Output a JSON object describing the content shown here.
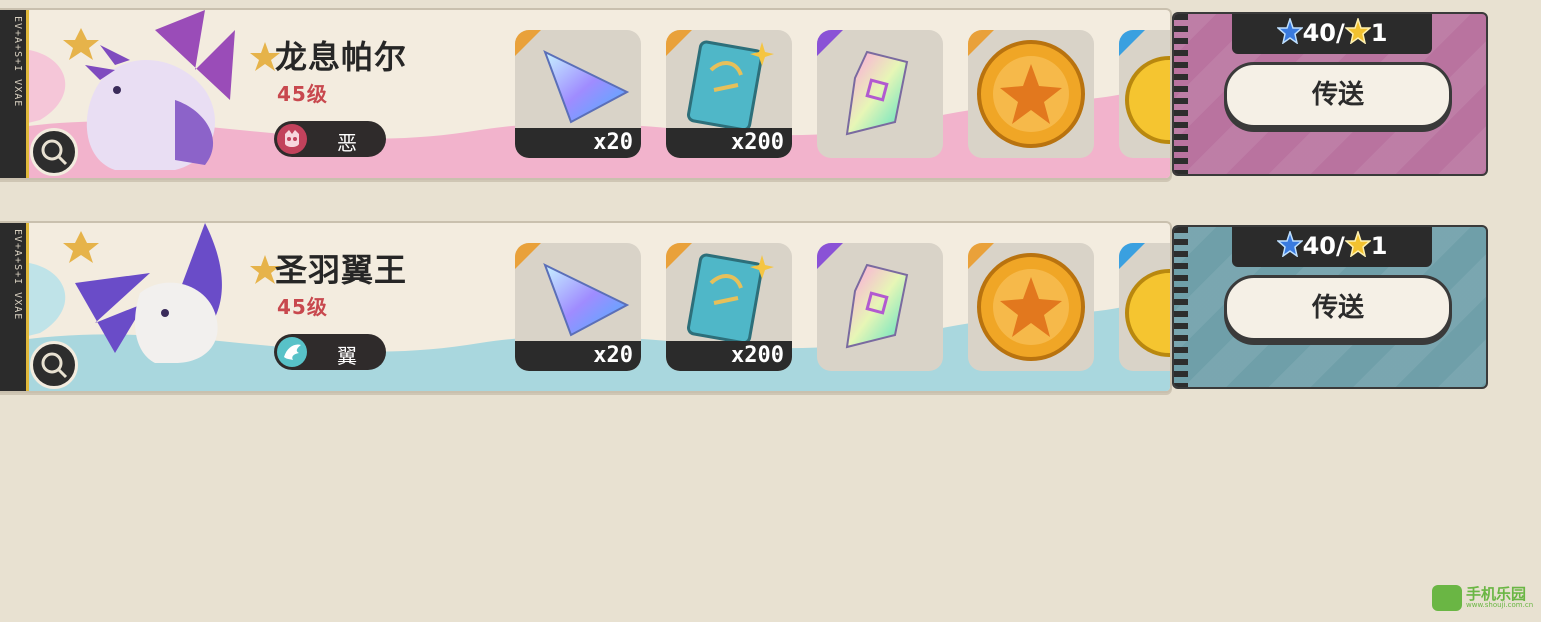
{
  "colors": {
    "background": "#e8e1d1",
    "card1_accent": "#f2b3cc",
    "card2_accent": "#a9d7de",
    "panel1": "#b9739f",
    "panel2": "#6f9fa9",
    "level_red": "#c8484e"
  },
  "cards": [
    {
      "name": "龙息帕尔",
      "level": "45级",
      "type_label": "恶",
      "type_icon": "dark-type-icon",
      "side_text": "EV+A+S+I VXAE",
      "items": [
        {
          "icon": "prism-crystal-icon",
          "qty": "x20"
        },
        {
          "icon": "skill-book-icon",
          "qty": "x200"
        },
        {
          "icon": "gem-shard-icon",
          "qty": ""
        },
        {
          "icon": "gold-medal-icon",
          "qty": ""
        }
      ],
      "stars": "40/",
      "stars_gold": "1",
      "button": "传送"
    },
    {
      "name": "圣羽翼王",
      "level": "45级",
      "type_label": "翼",
      "type_icon": "wing-type-icon",
      "side_text": "EV+A+S+I VXAE",
      "items": [
        {
          "icon": "prism-crystal-icon",
          "qty": "x20"
        },
        {
          "icon": "skill-book-icon",
          "qty": "x200"
        },
        {
          "icon": "gem-shard-icon",
          "qty": ""
        },
        {
          "icon": "gold-medal-icon",
          "qty": ""
        }
      ],
      "stars": "40/",
      "stars_gold": "1",
      "button": "传送"
    }
  ],
  "watermark": {
    "text": "手机乐园",
    "sub": "www.shouji.com.cn"
  }
}
